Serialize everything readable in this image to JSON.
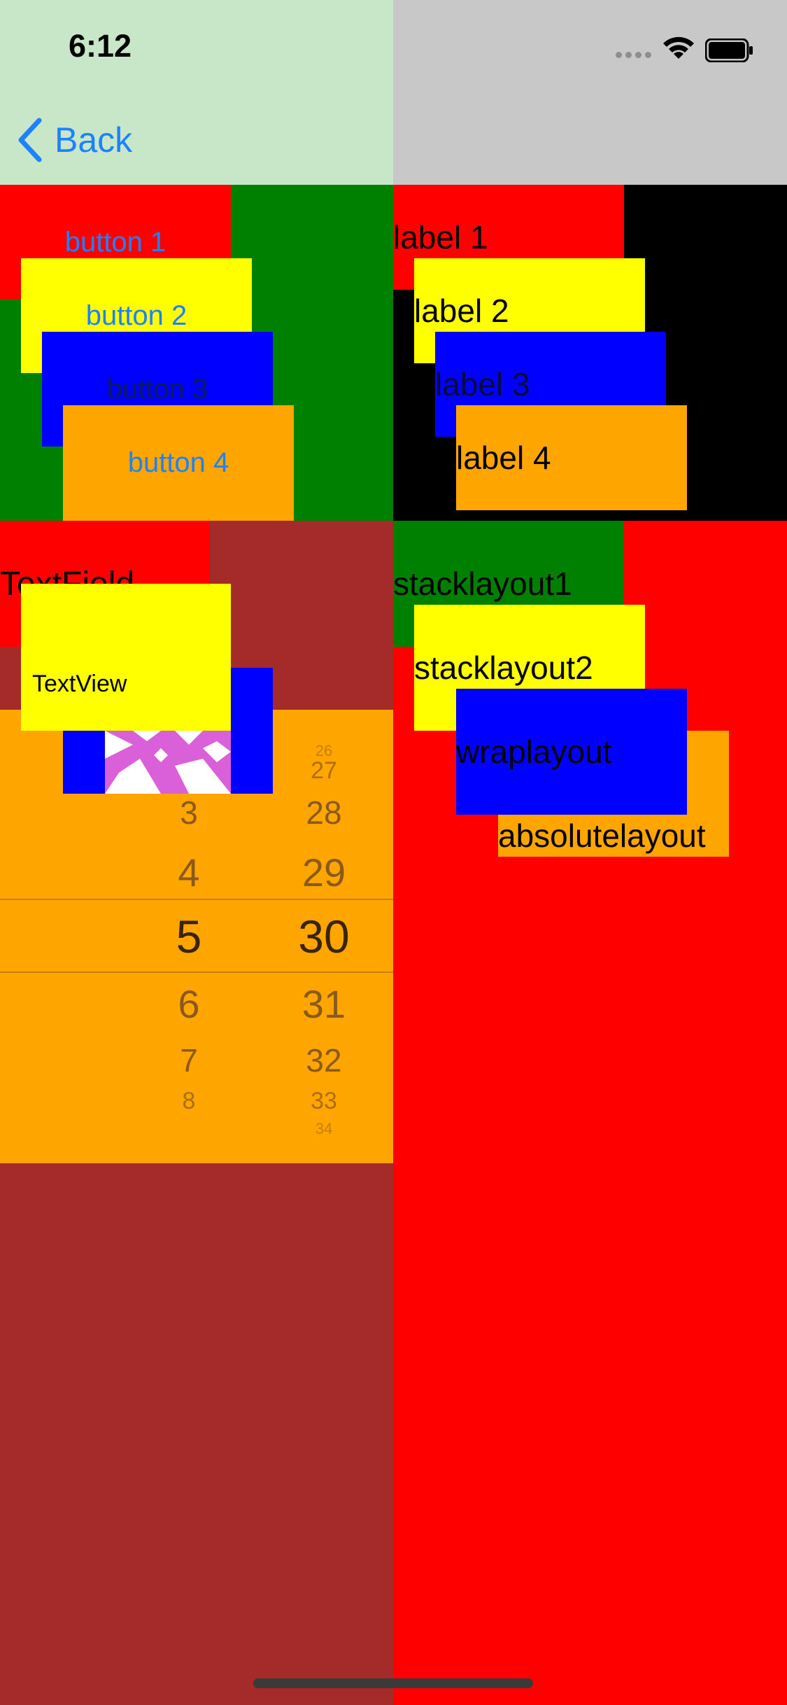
{
  "status": {
    "time": "6:12"
  },
  "nav": {
    "back_label": "Back"
  },
  "buttons": [
    "button 1",
    "button 2",
    "button 3",
    "button 4"
  ],
  "labels": [
    "label 1",
    "label 2",
    "label 3",
    "label 4"
  ],
  "inputs": {
    "textfield": "TextField",
    "textview": "TextView"
  },
  "picker": {
    "col1": [
      "3",
      "4",
      "5",
      "6",
      "7",
      "8"
    ],
    "col2": [
      "26",
      "27",
      "28",
      "29",
      "30",
      "31",
      "32",
      "33",
      "34"
    ],
    "selected_col1": "5",
    "selected_col2": "30"
  },
  "layouts": [
    "stacklayout1",
    "stacklayout2",
    "wraplayout",
    "absolutelayout"
  ],
  "colors": {
    "accent": "#1e82ff",
    "red": "#ff0000",
    "yellow": "#ffff00",
    "blue": "#0000ff",
    "orange": "#ffa500",
    "green": "#008000",
    "brown": "#a52a2a"
  }
}
